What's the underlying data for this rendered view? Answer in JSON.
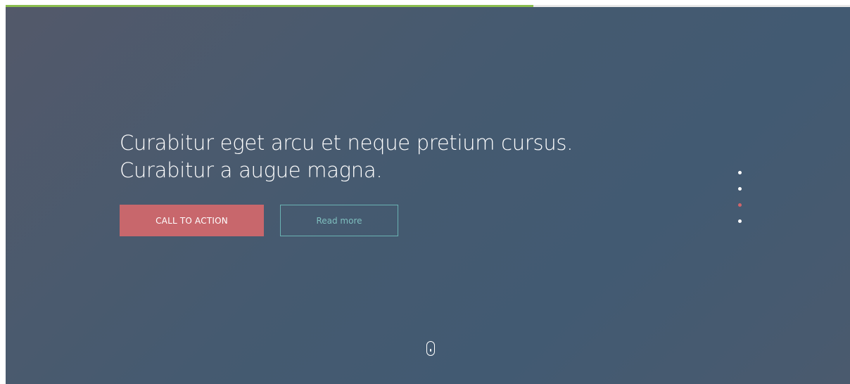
{
  "hero": {
    "headline_line1": "Curabitur eget arcu et neque pretium cursus.",
    "headline_line2": "Curabitur a augue magna.",
    "primary_button": "CALL TO ACTION",
    "secondary_button": "Read more"
  },
  "progress": {
    "value_percent": 62.5,
    "color": "#8bbd4f"
  },
  "slider_nav": {
    "total_slides": 4,
    "active_index": 2,
    "active_color": "#d0656a"
  },
  "scroll_indicator": {
    "icon": "mouse-scroll-icon"
  }
}
